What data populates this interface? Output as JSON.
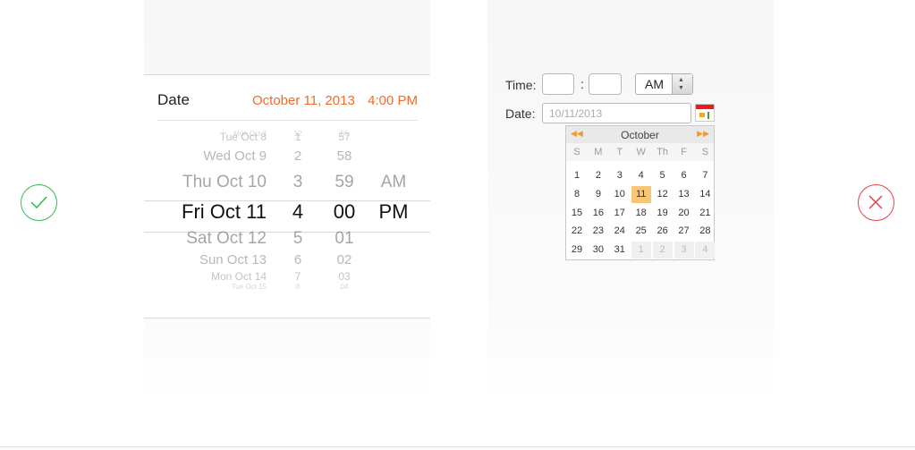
{
  "left": {
    "label": "Date",
    "selected_date": "October 11, 2013",
    "selected_time": "4:00 PM",
    "rows": [
      {
        "day": "Mon Oct 7",
        "hour": "12",
        "min": "56",
        "ampm": ""
      },
      {
        "day": "Tue Oct 8",
        "hour": "1",
        "min": "57",
        "ampm": ""
      },
      {
        "day": "Wed Oct 9",
        "hour": "2",
        "min": "58",
        "ampm": ""
      },
      {
        "day": "Thu Oct 10",
        "hour": "3",
        "min": "59",
        "ampm": "AM"
      },
      {
        "day": "Fri Oct 11",
        "hour": "4",
        "min": "00",
        "ampm": "PM"
      },
      {
        "day": "Sat Oct 12",
        "hour": "5",
        "min": "01",
        "ampm": ""
      },
      {
        "day": "Sun Oct 13",
        "hour": "6",
        "min": "02",
        "ampm": ""
      },
      {
        "day": "Mon Oct 14",
        "hour": "7",
        "min": "03",
        "ampm": ""
      },
      {
        "day": "Tue Oct 15",
        "hour": "8",
        "min": "04",
        "ampm": ""
      }
    ],
    "badge_icon": "checkmark-icon",
    "badge_color": "#2fbf4a"
  },
  "right": {
    "time_label": "Time:",
    "colon": ":",
    "hour_value": "",
    "minute_value": "",
    "ampm_value": "AM",
    "date_label": "Date:",
    "date_placeholder": "10/11/2013",
    "calendar": {
      "month": "October",
      "prev_icon": "double-left-arrow-icon",
      "next_icon": "double-right-arrow-icon",
      "dow": [
        "S",
        "M",
        "T",
        "W",
        "Th",
        "F",
        "S"
      ],
      "weeks": [
        [
          "1",
          "2",
          "3",
          "4",
          "5",
          "6",
          "7"
        ],
        [
          "8",
          "9",
          "10",
          "11",
          "12",
          "13",
          "14"
        ],
        [
          "15",
          "16",
          "17",
          "18",
          "19",
          "20",
          "21"
        ],
        [
          "22",
          "23",
          "24",
          "25",
          "26",
          "27",
          "28"
        ],
        [
          "29",
          "30",
          "31",
          "1",
          "2",
          "3",
          "4"
        ]
      ],
      "selected": "11"
    },
    "badge_icon": "x-icon",
    "badge_color": "#e8404a"
  },
  "colors": {
    "accent_orange": "#f26a2a",
    "calendar_highlight": "#f7c679"
  }
}
